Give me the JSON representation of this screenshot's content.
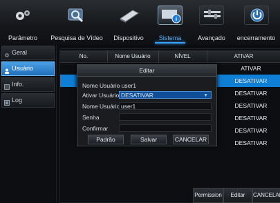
{
  "top_tabs": [
    {
      "label": "Parâmetro",
      "icon": "gear-icon"
    },
    {
      "label": "Pesquisa de Vídeo",
      "icon": "search-video-icon"
    },
    {
      "label": "Dispositivo",
      "icon": "hard-drive-icon"
    },
    {
      "label": "Sistema",
      "icon": "system-info-icon"
    },
    {
      "label": "Avançado",
      "icon": "advanced-icon"
    },
    {
      "label": "encerramento",
      "icon": "power-icon"
    }
  ],
  "active_tab": "Sistema",
  "sidebar": {
    "items": [
      {
        "label": "Geral",
        "icon": "gear-icon"
      },
      {
        "label": "Usuário",
        "icon": "user-icon"
      },
      {
        "label": "Info.",
        "icon": "info-icon"
      },
      {
        "label": "Log",
        "icon": "log-icon"
      }
    ],
    "active": "Usuário"
  },
  "table": {
    "headers": [
      "No.",
      "Nome Usuário",
      "NÍVEL",
      "ATIVAR"
    ],
    "rows": [
      {
        "level": "ATIVAR"
      },
      {
        "level": "DESATIVAR"
      },
      {
        "level": "DESATIVAR"
      },
      {
        "level": "DESATIVAR"
      },
      {
        "level": "DESATIVAR"
      },
      {
        "level": "DESATIVAR"
      },
      {
        "level": "DESATIVAR"
      }
    ]
  },
  "bottom_buttons": [
    "Permission",
    "Editar",
    "CANCELAR"
  ],
  "dialog": {
    "title": "Editar",
    "user_line": "Nome Usuário user1",
    "activate_label": "Ativar Usuário",
    "activate_value": "DESATIVAR",
    "name_label": "Nome Usuário",
    "name_value": "user1",
    "password_label": "Senha",
    "password_value": "",
    "confirm_label": "Confirmar",
    "confirm_value": "",
    "buttons": [
      "Padrão",
      "Salvar",
      "CANCELAR"
    ]
  },
  "colors": {
    "accent": "#0f7fd6",
    "background": "#0b0d10",
    "panel": "#1a1c1f"
  }
}
